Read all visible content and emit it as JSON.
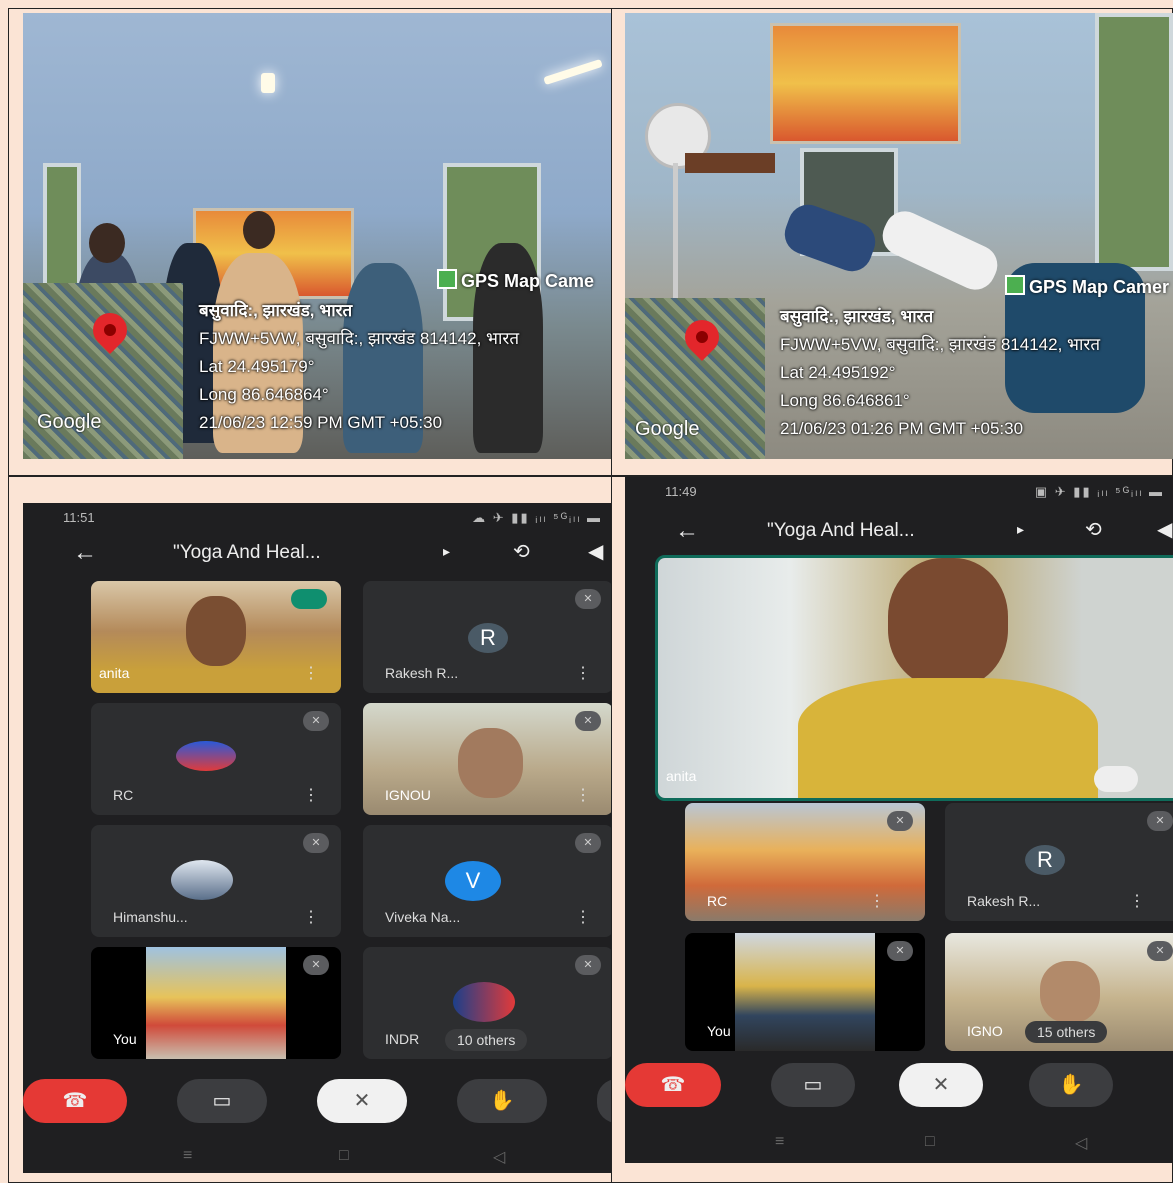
{
  "gps_photo_1": {
    "app_tag": "GPS Map Came",
    "address_line1": "बसुवादि:, झारखंड, भारत",
    "address_line2": "FJWW+5VW, बसुवादि:, झारखंड 814142, भारत",
    "lat": "Lat 24.495179°",
    "long": "Long 86.646864°",
    "timestamp": "21/06/23 12:59 PM GMT +05:30",
    "map_label": "Google"
  },
  "gps_photo_2": {
    "app_tag": "GPS Map Camer",
    "address_line1": "बसुवादि:, झारखंड, भारत",
    "address_line2": "FJWW+5VW, बसुवादि:, झारखंड 814142, भारत",
    "lat": "Lat 24.495192°",
    "long": "Long 86.646861°",
    "timestamp": "21/06/23 01:26 PM GMT +05:30",
    "map_label": "Google"
  },
  "meet_1": {
    "status_time": "11:51",
    "status_icons": "☁ ✈ ▮▮ ᵢₗₗ ⁵ᴳᵢₗₗ ▬",
    "title": "\"Yoga And Heal...",
    "tiles": [
      {
        "name": "anita"
      },
      {
        "name": "Rakesh R...",
        "avatar": "R"
      },
      {
        "name": "RC"
      },
      {
        "name": "IGNOU"
      },
      {
        "name": "Himanshu..."
      },
      {
        "name": "Viveka Na...",
        "avatar": "V"
      },
      {
        "name": "You"
      },
      {
        "name": "INDR"
      }
    ],
    "others": "10 others"
  },
  "meet_2": {
    "status_time": "11:49",
    "status_icons": "▣ ✈ ▮▮ ᵢₗₗ ⁵ᴳᵢₗₗ ▬",
    "title": "\"Yoga And Heal...",
    "main_name": "anita",
    "tiles": [
      {
        "name": "RC"
      },
      {
        "name": "Rakesh R...",
        "avatar": "R"
      },
      {
        "name": "You"
      },
      {
        "name": "IGNO"
      }
    ],
    "others": "15 others"
  },
  "colors": {
    "page_bg": "#fbe4d5",
    "end_call": "#e53935",
    "avatar_v": "#1e88e5",
    "avatar_r": "#4a5a66"
  }
}
